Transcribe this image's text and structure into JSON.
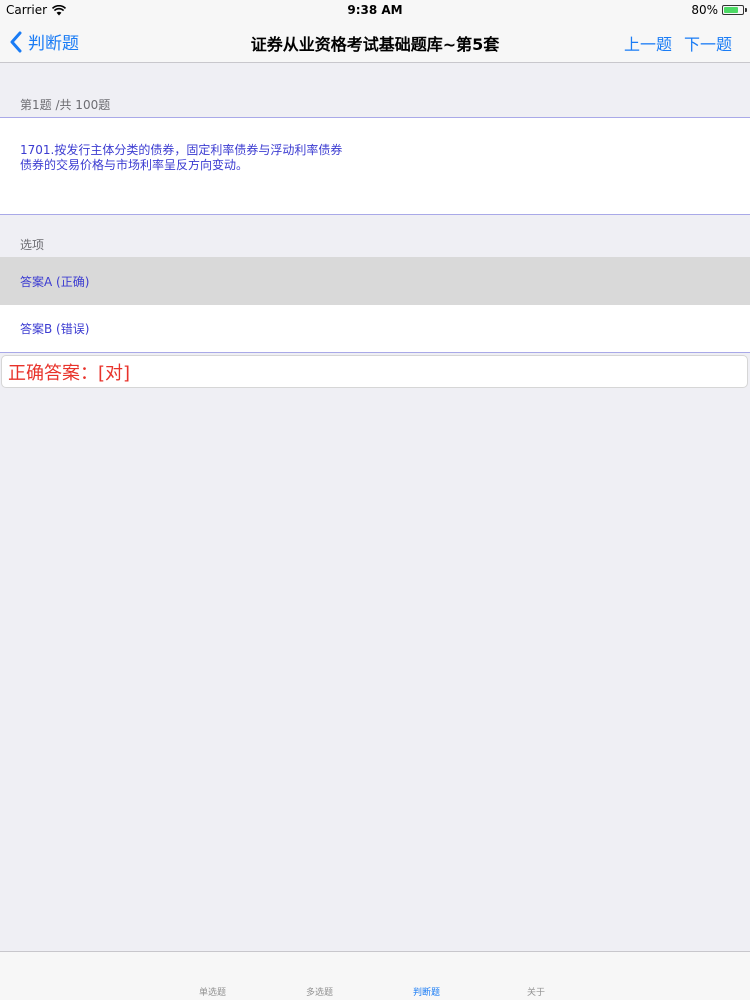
{
  "status_bar": {
    "carrier": "Carrier",
    "time": "9:38 AM",
    "battery": "80%",
    "battery_level": 0.8
  },
  "nav": {
    "back_label": "判断题",
    "title": "证券从业资格考试基础题库~第5套",
    "prev_label": "上一题",
    "next_label": "下一题"
  },
  "question": {
    "counter": "第1题 /共 100题",
    "line1": "1701.按发行主体分类的债券，固定利率债券与浮动利率债券",
    "line2": "债券的交易价格与市场利率呈反方向变动。"
  },
  "options": {
    "header": "选项",
    "a": "答案A (正确)",
    "b": "答案B (错误)"
  },
  "answer": "正确答案：[对]",
  "tabs": [
    "单选题",
    "多选题",
    "判断题",
    "关于"
  ],
  "colors": {
    "accent": "#1a7cf5",
    "question_text": "#3b3bd1",
    "answer_text": "#e8322a"
  }
}
